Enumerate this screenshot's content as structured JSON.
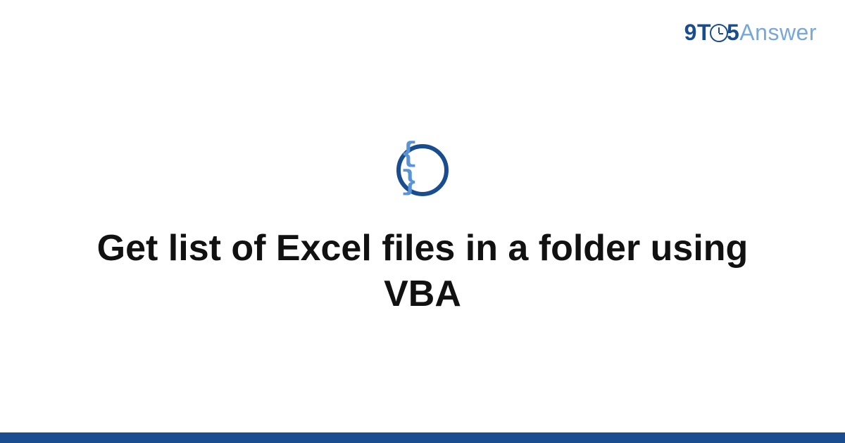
{
  "brand": {
    "nine": "9",
    "t": "T",
    "five": "5",
    "answer": "Answer"
  },
  "badge": {
    "glyph": "{ }"
  },
  "card": {
    "title": "Get list of Excel files in a folder using VBA"
  }
}
